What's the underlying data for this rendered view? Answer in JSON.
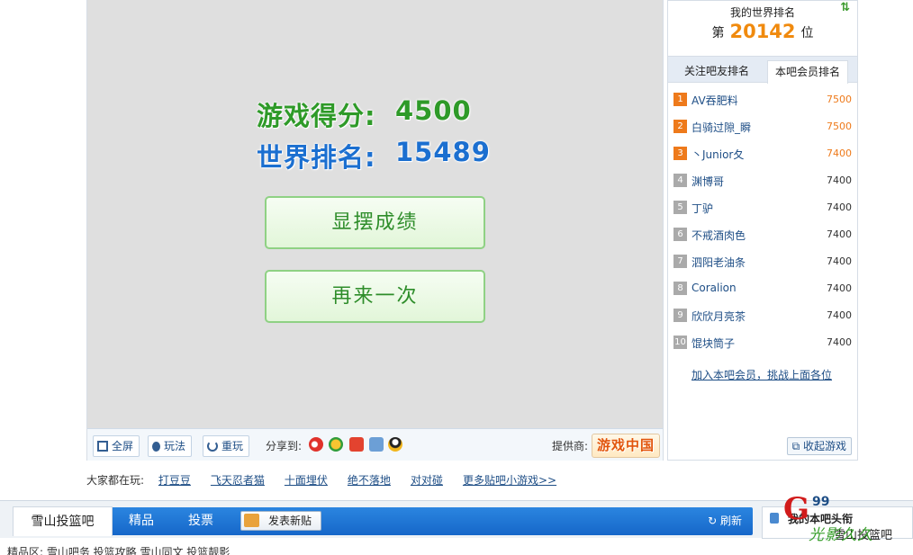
{
  "game": {
    "score_label": "游戏得分:",
    "score_value": "4500",
    "rank_label": "世界排名:",
    "rank_value": "15489",
    "show_button": "显摆成绩",
    "again_button": "再来一次"
  },
  "toolbar": {
    "fullscreen": "全屏",
    "howto": "玩法",
    "replay": "重玩",
    "share_label": "分享到:",
    "share_icons": [
      "weibo-icon",
      "renren-icon",
      "kaixin-icon",
      "douban-icon",
      "qq-icon"
    ],
    "provider_label": "提供商:",
    "provider_logo": "游戏中国"
  },
  "sidebar": {
    "world_rank_title": "我的世界排名",
    "world_rank_prefix": "第",
    "world_rank_value": "20142",
    "world_rank_suffix": "位",
    "tab_friends": "关注吧友排名",
    "tab_members": "本吧会员排名",
    "ranking": [
      {
        "rank": "1",
        "name": "AV吞肥料",
        "score": "7500"
      },
      {
        "rank": "2",
        "name": "白骑过隙_瞬",
        "score": "7500"
      },
      {
        "rank": "3",
        "name": "丶Junior夂",
        "score": "7400"
      },
      {
        "rank": "4",
        "name": "渊博哥",
        "score": "7400"
      },
      {
        "rank": "5",
        "name": "丁驴",
        "score": "7400"
      },
      {
        "rank": "6",
        "name": "不戒酒肉色",
        "score": "7400"
      },
      {
        "rank": "7",
        "name": "泗阳老油条",
        "score": "7400"
      },
      {
        "rank": "8",
        "name": "Coralion",
        "score": "7400"
      },
      {
        "rank": "9",
        "name": "欣欣月亮茶",
        "score": "7400"
      },
      {
        "rank": "10",
        "name": "馄块筒子",
        "score": "7400"
      }
    ],
    "join_link": "加入本吧会员，挑战上面各位",
    "collapse_button": "收起游戏"
  },
  "also_played": {
    "label": "大家都在玩:",
    "games": [
      "打豆豆",
      "飞天忍者猫",
      "十面埋伏",
      "绝不落地",
      "对对碰",
      "更多贴吧小游戏>>"
    ]
  },
  "nav": {
    "bar_name": "雪山投篮吧",
    "tab_good": "精品",
    "tab_vote": "投票",
    "post_button": "发表新贴",
    "refresh": "刷新",
    "headline_title": "我的本吧头衔",
    "headline_sub": "雪山投篮吧"
  },
  "watermark": {
    "letter": "G",
    "number": "99",
    "text": "光影久久"
  },
  "bottom_strip": "精品区:  雪山吧务  投篮攻略  雪山同文  投篮靓影",
  "colors": {
    "score_green": "#2e9a28",
    "rank_blue": "#1b6fd0",
    "rank_orange": "#ee7a1b",
    "nav_blue": "#1f75d6"
  }
}
